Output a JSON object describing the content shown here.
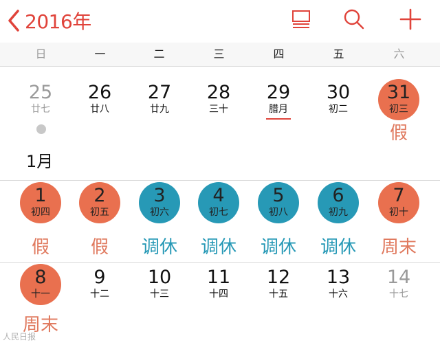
{
  "header": {
    "year_label": "2016年",
    "icons": [
      "chevron-left-icon",
      "list-view-icon",
      "search-icon",
      "add-icon"
    ]
  },
  "colors": {
    "accent": "#e0433a",
    "holiday": "#e9704f",
    "workday": "#2799b6",
    "holiday_text": "#e07a5f"
  },
  "weekdays": [
    "日",
    "一",
    "二",
    "三",
    "四",
    "五",
    "六"
  ],
  "month_marker": "1月",
  "weeks": [
    [
      {
        "day": "25",
        "lunar": "廿七",
        "tag": "",
        "style": "grey"
      },
      {
        "day": "26",
        "lunar": "廿八",
        "tag": "",
        "style": "normal"
      },
      {
        "day": "27",
        "lunar": "廿九",
        "tag": "",
        "style": "normal"
      },
      {
        "day": "28",
        "lunar": "三十",
        "tag": "",
        "style": "normal"
      },
      {
        "day": "29",
        "lunar": "腊月",
        "tag": "",
        "style": "normal",
        "underline": true
      },
      {
        "day": "30",
        "lunar": "初二",
        "tag": "",
        "style": "normal"
      },
      {
        "day": "31",
        "lunar": "初三",
        "tag": "假",
        "style": "holiday"
      }
    ],
    [
      {
        "day": "1",
        "lunar": "初四",
        "tag": "假",
        "style": "holiday"
      },
      {
        "day": "2",
        "lunar": "初五",
        "tag": "假",
        "style": "holiday"
      },
      {
        "day": "3",
        "lunar": "初六",
        "tag": "调休",
        "style": "workday"
      },
      {
        "day": "4",
        "lunar": "初七",
        "tag": "调休",
        "style": "workday"
      },
      {
        "day": "5",
        "lunar": "初八",
        "tag": "调休",
        "style": "workday"
      },
      {
        "day": "6",
        "lunar": "初九",
        "tag": "调休",
        "style": "workday"
      },
      {
        "day": "7",
        "lunar": "初十",
        "tag": "周末",
        "style": "holiday"
      }
    ],
    [
      {
        "day": "8",
        "lunar": "十一",
        "tag": "周末",
        "style": "holiday"
      },
      {
        "day": "9",
        "lunar": "十二",
        "tag": "",
        "style": "normal"
      },
      {
        "day": "10",
        "lunar": "十三",
        "tag": "",
        "style": "normal"
      },
      {
        "day": "11",
        "lunar": "十四",
        "tag": "",
        "style": "normal"
      },
      {
        "day": "12",
        "lunar": "十五",
        "tag": "",
        "style": "normal"
      },
      {
        "day": "13",
        "lunar": "十六",
        "tag": "",
        "style": "normal"
      },
      {
        "day": "14",
        "lunar": "十七",
        "tag": "",
        "style": "grey"
      }
    ]
  ],
  "watermark": "人民日报"
}
